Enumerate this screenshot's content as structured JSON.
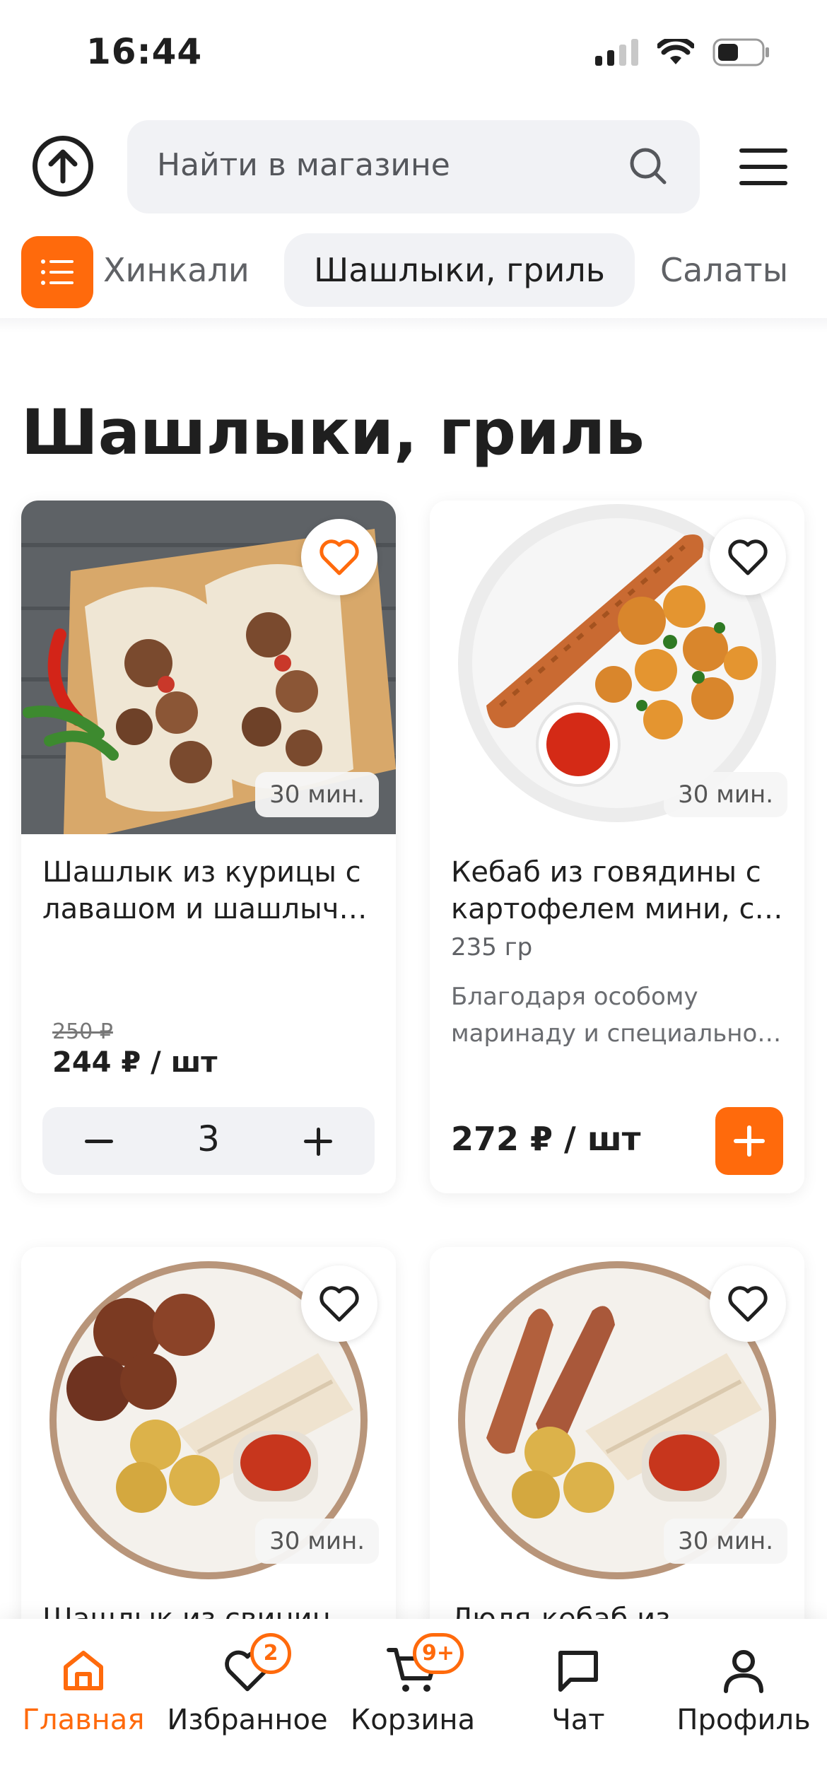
{
  "status_bar": {
    "time": "16:44"
  },
  "header": {
    "search_placeholder": "Найти в магазине"
  },
  "categories": {
    "items": [
      {
        "label": "Хинкали"
      },
      {
        "label": "Шашлыки, гриль"
      },
      {
        "label": "Салаты"
      }
    ],
    "active": "Шашлыки, гриль"
  },
  "section": {
    "title": "Шашлыки, гриль"
  },
  "products": [
    {
      "name_line1": "Шашлык из курицы с",
      "name_line2": "лавашом и шашлычн...",
      "time": "30 мин.",
      "old_price": "250 ₽",
      "price": "244 ₽ / шт",
      "quantity": "3",
      "favorite": true
    },
    {
      "name_line1": "Кебаб из говядины с",
      "name_line2": "картофелем мини, со...",
      "weight": "235 гр",
      "desc_line1": "Благодаря особому",
      "desc_line2": "маринаду и специальной...",
      "time": "30 мин.",
      "price": "272 ₽ / шт",
      "favorite": false
    },
    {
      "name_partial": "Шашлык из свинины с",
      "time": "30 мин.",
      "favorite": false
    },
    {
      "name_partial": "Люля-кебаб из",
      "time": "30 мин.",
      "favorite": false
    }
  ],
  "bottom_nav": {
    "items": [
      {
        "label": "Главная",
        "icon": "home-icon",
        "active": true
      },
      {
        "label": "Избранное",
        "icon": "heart-icon",
        "badge": "2"
      },
      {
        "label": "Корзина",
        "icon": "cart-icon",
        "badge": "9+"
      },
      {
        "label": "Чат",
        "icon": "chat-icon"
      },
      {
        "label": "Профиль",
        "icon": "profile-icon"
      }
    ]
  },
  "colors": {
    "accent": "#ff6a0c",
    "surface": "#f1f2f5",
    "text": "#1f1f1f"
  }
}
